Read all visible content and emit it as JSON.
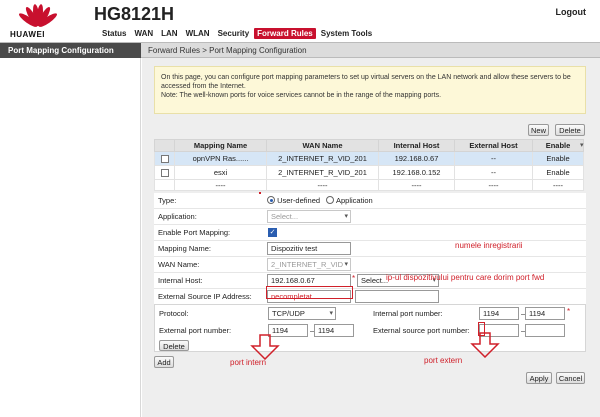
{
  "brand": {
    "logo_text": "HUAWEI",
    "model": "HG8121H",
    "accent": "#c8102e"
  },
  "header": {
    "logout": "Logout"
  },
  "nav": [
    "Status",
    "WAN",
    "LAN",
    "WLAN",
    "Security",
    "Forward Rules",
    "System Tools"
  ],
  "nav_active": "Forward Rules",
  "left_menu": {
    "title": "Port Mapping Configuration"
  },
  "breadcrumb": "Forward Rules > Port Mapping Configuration",
  "note": {
    "line1": "On this page, you can configure port mapping parameters to set up virtual servers on the LAN network and allow these servers to be accessed from the Internet.",
    "line2": "Note: The well-known ports for voice services cannot be in the range of the mapping ports."
  },
  "buttons": {
    "new": "New",
    "delete_top": "Delete",
    "delete_port": "Delete",
    "add": "Add",
    "apply": "Apply",
    "cancel": "Cancel"
  },
  "table": {
    "headers": [
      "",
      "Mapping Name",
      "WAN Name",
      "Internal Host",
      "External Host",
      "Enable"
    ],
    "rows": [
      {
        "name": "opnVPN Ras......",
        "wan": "2_INTERNET_R_VID_201",
        "internal": "192.168.0.67",
        "external": "--",
        "enable": "Enable"
      },
      {
        "name": "esxi",
        "wan": "2_INTERNET_R_VID_201",
        "internal": "192.168.0.152",
        "external": "--",
        "enable": "Enable"
      }
    ],
    "dash_row": [
      "",
      "----",
      "----",
      "----",
      "----",
      "----"
    ]
  },
  "form": {
    "type_label": "Type:",
    "type_user": "User-defined",
    "type_app": "Application",
    "application_label": "Application:",
    "application_value": "Select...",
    "enable_label": "Enable Port Mapping:",
    "mapping_name_label": "Mapping Name:",
    "mapping_name_value": "Dispozitiv test",
    "wan_label": "WAN Name:",
    "wan_value": "2_INTERNET_R_VID",
    "internal_host_label": "Internal Host:",
    "internal_host_value": "192.168.0.67",
    "internal_host_select": "Select...",
    "external_ip_label": "External Source IP Address:",
    "external_ip_value": "necompletat"
  },
  "ports": {
    "protocol_label": "Protocol:",
    "protocol_value": "TCP/UDP",
    "internal_label": "Internal port number:",
    "internal_from": "1194",
    "internal_to": "1194",
    "external_label": "External port number:",
    "external_from": "1194",
    "external_to": "1194",
    "ext_source_label": "External source port number:",
    "ext_source_from": "",
    "ext_source_to": ""
  },
  "annotations": {
    "name_note": "numele inregistrarii",
    "host_note": "ip-ul dispozitivului pentru care dorim port fwd",
    "port_intern": "port intern",
    "port_extern": "port extern"
  }
}
